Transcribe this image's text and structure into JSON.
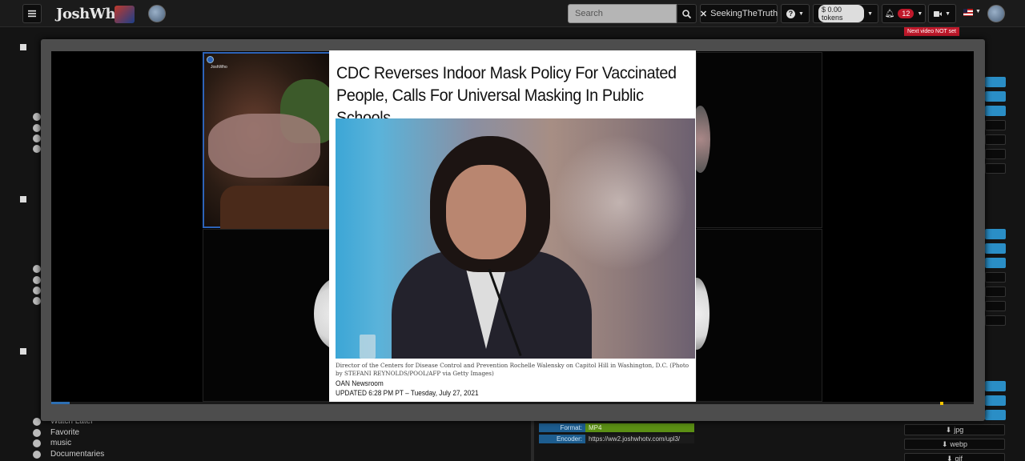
{
  "navbar": {
    "brand": "JoshWho",
    "search_placeholder": "Search",
    "seeking_label": "SeekingTheTruth",
    "tokens_label": "$ 0.00 tokens",
    "notification_count": "12",
    "next_video_notice": "Next video NOT set"
  },
  "sidebar": {
    "items": [
      "Watch Later",
      "Favorite",
      "music",
      "Documentaries"
    ]
  },
  "video_meta": {
    "format_label": "Format:",
    "format_value": "MP4",
    "encoder_label": "Encoder:",
    "encoder_value": "https://ww2.joshwhotv.com/upl3/"
  },
  "downloads": {
    "jpg": "jpg",
    "webp": "webp",
    "gif": "gif"
  },
  "video": {
    "cam_label": "JoshWho",
    "progress": 0.02,
    "news": {
      "headline_line1": "CDC Reverses Indoor Mask Policy For Vaccinated",
      "headline_line2": "People, Calls For Universal Masking In Public Schools",
      "caption": "Director of the Centers for Disease Control and Prevention Rochelle Walensky on Capitol Hill in Washington, D.C. (Photo by STEFANI REYNOLDS/POOL/AFP via Getty Images)",
      "source": "OAN Newsroom",
      "updated": "UPDATED 6:28 PM PT – Tuesday, July 27, 2021"
    }
  },
  "colors": {
    "accent_blue": "#2a8ec6",
    "badge_red": "#c0192b",
    "format_green": "#5b8f14"
  }
}
